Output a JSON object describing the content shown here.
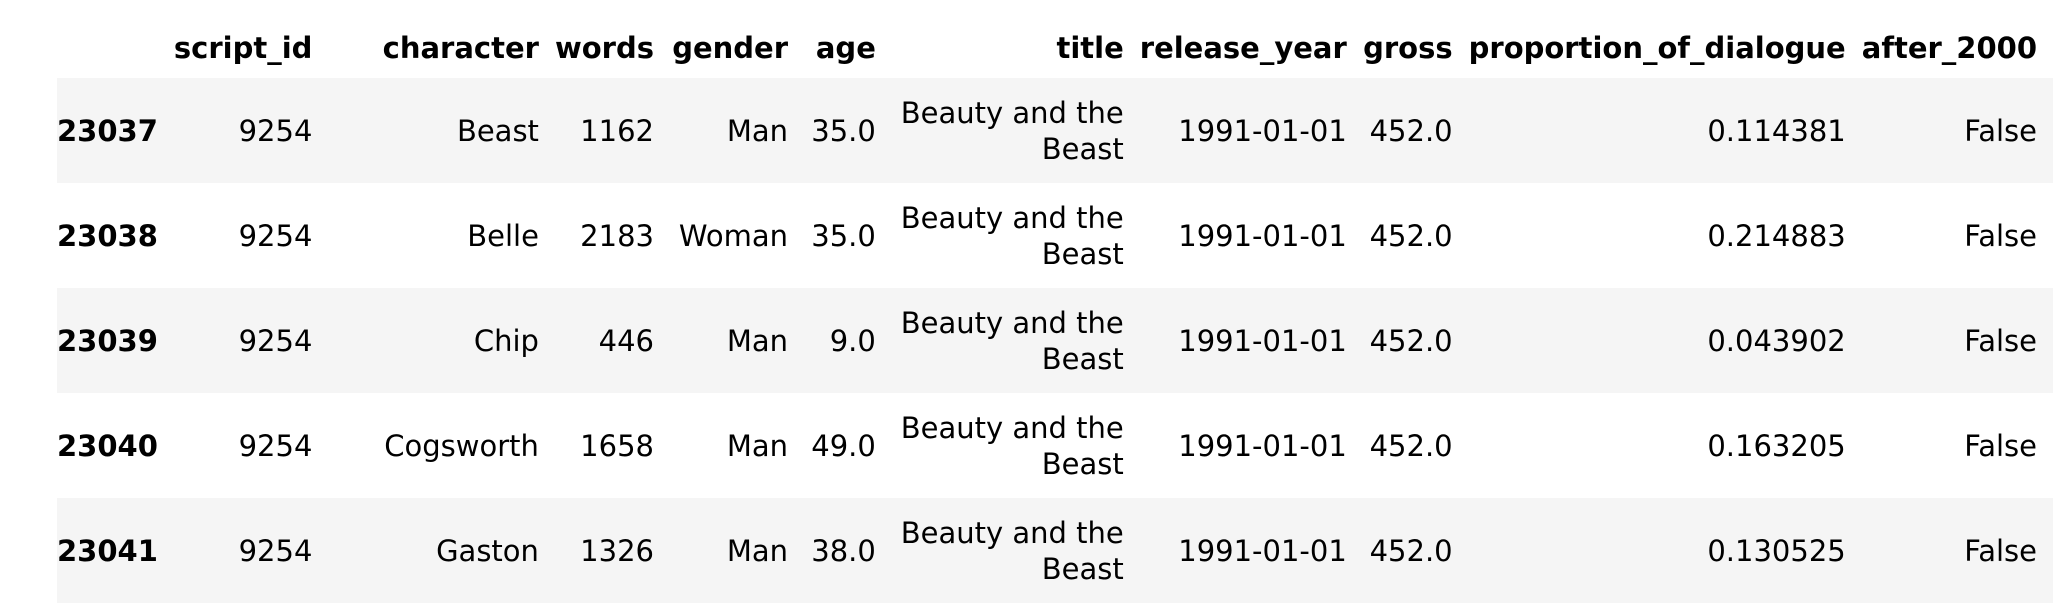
{
  "table": {
    "columns": [
      "",
      "script_id",
      "character",
      "words",
      "gender",
      "age",
      "title",
      "release_year",
      "gross",
      "proportion_of_dialogue",
      "after_2000"
    ],
    "rows": [
      {
        "index": "23037",
        "script_id": "9254",
        "character": "Beast",
        "words": "1162",
        "gender": "Man",
        "age": "35.0",
        "title_line1": "Beauty and the",
        "title_line2": "Beast",
        "release_year": "1991-01-01",
        "gross": "452.0",
        "proportion_of_dialogue": "0.114381",
        "after_2000": "False"
      },
      {
        "index": "23038",
        "script_id": "9254",
        "character": "Belle",
        "words": "2183",
        "gender": "Woman",
        "age": "35.0",
        "title_line1": "Beauty and the",
        "title_line2": "Beast",
        "release_year": "1991-01-01",
        "gross": "452.0",
        "proportion_of_dialogue": "0.214883",
        "after_2000": "False"
      },
      {
        "index": "23039",
        "script_id": "9254",
        "character": "Chip",
        "words": "446",
        "gender": "Man",
        "age": "9.0",
        "title_line1": "Beauty and the",
        "title_line2": "Beast",
        "release_year": "1991-01-01",
        "gross": "452.0",
        "proportion_of_dialogue": "0.043902",
        "after_2000": "False"
      },
      {
        "index": "23040",
        "script_id": "9254",
        "character": "Cogsworth",
        "words": "1658",
        "gender": "Man",
        "age": "49.0",
        "title_line1": "Beauty and the",
        "title_line2": "Beast",
        "release_year": "1991-01-01",
        "gross": "452.0",
        "proportion_of_dialogue": "0.163205",
        "after_2000": "False"
      },
      {
        "index": "23041",
        "script_id": "9254",
        "character": "Gaston",
        "words": "1326",
        "gender": "Man",
        "age": "38.0",
        "title_line1": "Beauty and the",
        "title_line2": "Beast",
        "release_year": "1991-01-01",
        "gross": "452.0",
        "proportion_of_dialogue": "0.130525",
        "after_2000": "False"
      }
    ]
  },
  "colors": {
    "stripe": "#f5f5f5",
    "text": "#000000",
    "background": "#ffffff"
  }
}
